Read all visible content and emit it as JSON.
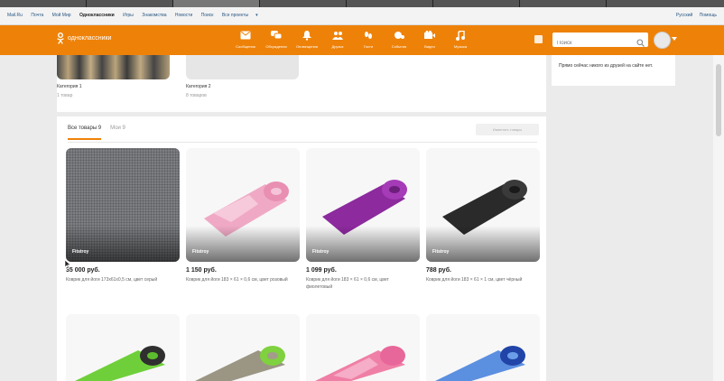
{
  "browser": {
    "tabs": [
      "",
      "",
      "",
      "",
      "",
      "",
      "",
      ""
    ]
  },
  "mailbar": {
    "links": [
      "Mail.Ru",
      "Почта",
      "Мой Мир",
      "Одноклассники",
      "Игры",
      "Знакомства",
      "Новости",
      "Поиск",
      "Все проекты"
    ],
    "active_index": 3,
    "right": [
      "Русский",
      "Помощь"
    ]
  },
  "header": {
    "logo_text": "одноклассники",
    "nav": [
      {
        "label": "Сообщения",
        "icon": "messages-icon"
      },
      {
        "label": "Обсуждения",
        "icon": "discussions-icon"
      },
      {
        "label": "Оповещения",
        "icon": "notifications-icon"
      },
      {
        "label": "Друзья",
        "icon": "friends-icon"
      },
      {
        "label": "Гости",
        "icon": "guests-icon"
      },
      {
        "label": "События",
        "icon": "events-icon"
      },
      {
        "label": "Видео",
        "icon": "video-icon"
      },
      {
        "label": "Музыка",
        "icon": "music-icon"
      }
    ],
    "search_placeholder": "Поиск",
    "colors": {
      "brand": "#ee8208"
    }
  },
  "categories": [
    {
      "name": "Категория 1",
      "count": "1 товар"
    },
    {
      "name": "Категория 2",
      "count": "8 товаров"
    }
  ],
  "friends_panel": {
    "text": "Прямо сейчас никого из друзей на сайте нет."
  },
  "products_section": {
    "tab_all": "Все товары 9",
    "tab_mine": "Мои 9",
    "manage_button": "Изменить товары"
  },
  "products": [
    {
      "brand": "Fitstroy",
      "price": "35 000 руб.",
      "desc": "Коврик для йоги 173х61х0,5 см, цвет серый"
    },
    {
      "brand": "Fitstroy",
      "price": "1 150 руб.",
      "desc": "Коврик для йоги 183 × 61 × 0,6 см, цвет розовый"
    },
    {
      "brand": "Fitstroy",
      "price": "1 099 руб.",
      "desc": "Коврик для йоги 183 × 61 × 0,6 см, цвет фиолетовый"
    },
    {
      "brand": "Fitstroy",
      "price": "788 руб.",
      "desc": "Коврик для йоги 183 × 61 × 1 см, цвет чёрный"
    }
  ]
}
